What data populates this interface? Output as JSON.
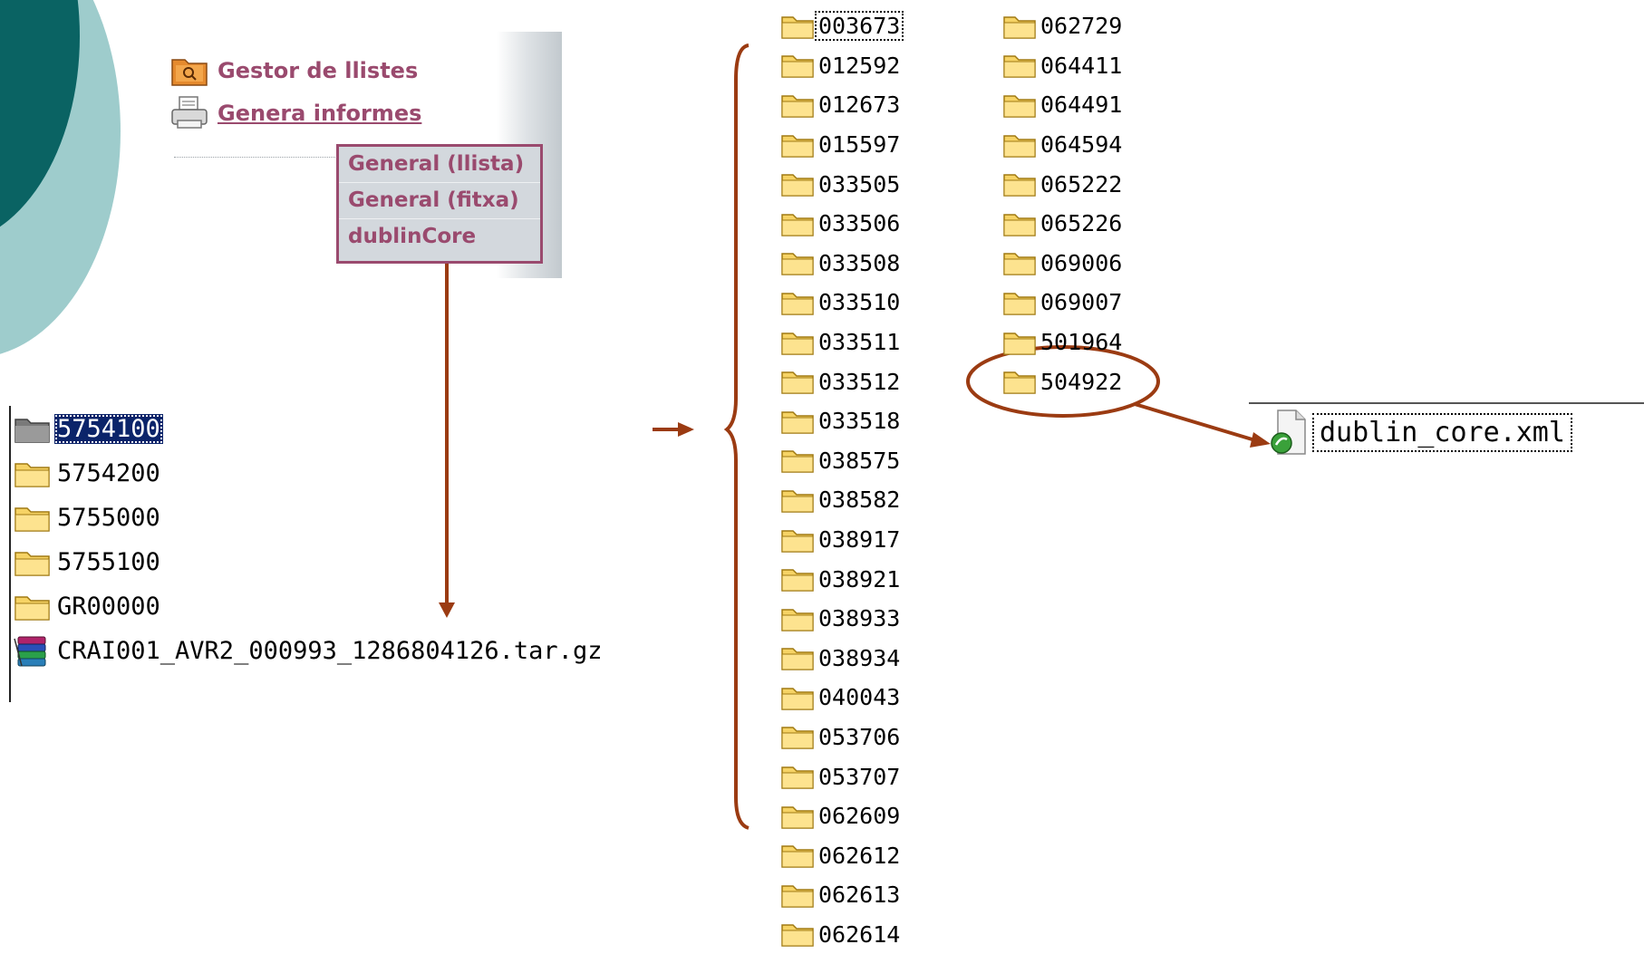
{
  "colors": {
    "accent": "#9a4a6e",
    "arrow": "#9b3b12",
    "selection": "#0b246a",
    "teal_dark": "#0a6363",
    "teal_light": "#9ecccc"
  },
  "menu": {
    "items": [
      {
        "label": "Gestor de llistes",
        "icon": "report-folder-icon"
      },
      {
        "label": "Genera informes ",
        "icon": "printer-icon"
      }
    ],
    "submenu": [
      "General (llista)",
      "General (fitxa)",
      "dublinCore"
    ]
  },
  "tree": {
    "items": [
      {
        "label": "5754100",
        "type": "folder",
        "selected": true
      },
      {
        "label": "5754200",
        "type": "folder"
      },
      {
        "label": "5755000",
        "type": "folder"
      },
      {
        "label": "5755100",
        "type": "folder"
      },
      {
        "label": "GR00000",
        "type": "folder"
      },
      {
        "label": "CRAI001_AVR2_000993_1286804126.tar.gz",
        "type": "archive"
      }
    ]
  },
  "folders": {
    "column1": [
      "003673",
      "012592",
      "012673",
      "015597",
      "033505",
      "033506",
      "033508",
      "033510",
      "033511",
      "033512",
      "033518",
      "038575",
      "038582",
      "038917",
      "038921",
      "038933",
      "038934",
      "040043",
      "053706",
      "053707",
      "062609",
      "062612",
      "062613",
      "062614"
    ],
    "column2": [
      "062729",
      "064411",
      "064491",
      "064594",
      "065222",
      "065226",
      "069006",
      "069007",
      "501964",
      "504922"
    ],
    "highlighted": "504922"
  },
  "file": {
    "name": "dublin_core.xml",
    "icon": "xml-file-icon"
  }
}
